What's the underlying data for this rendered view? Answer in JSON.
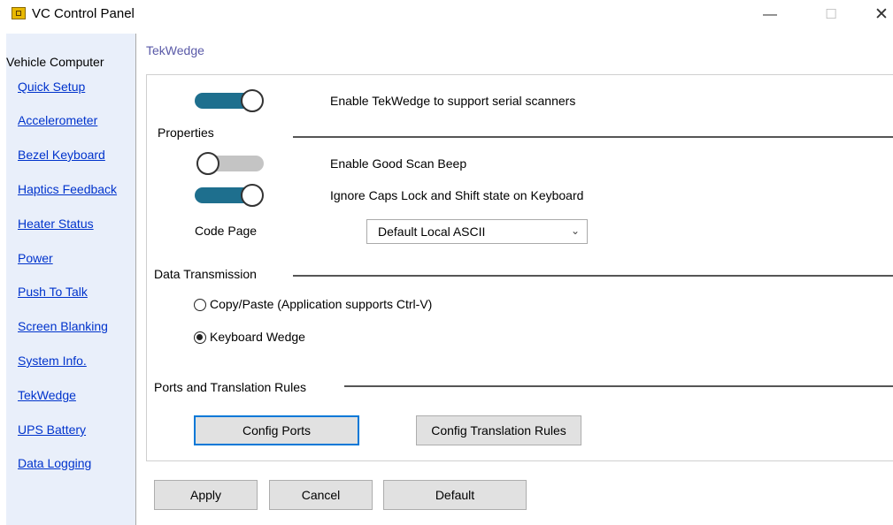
{
  "window": {
    "title": "VC Control Panel",
    "minimize": "—",
    "maximize": "☐",
    "close": "✕"
  },
  "sidebar": {
    "header": "Vehicle Computer",
    "items": [
      {
        "label": "Quick Setup"
      },
      {
        "label": "Accelerometer"
      },
      {
        "label": "Bezel Keyboard"
      },
      {
        "label": "Haptics Feedback"
      },
      {
        "label": "Heater Status"
      },
      {
        "label": "Power"
      },
      {
        "label": "Push To Talk"
      },
      {
        "label": "Screen Blanking"
      },
      {
        "label": "System Info."
      },
      {
        "label": "TekWedge"
      },
      {
        "label": "UPS Battery"
      },
      {
        "label": "Data Logging"
      }
    ]
  },
  "page": {
    "title": "TekWedge"
  },
  "main": {
    "enable_tekwedge": {
      "label": "Enable TekWedge to support serial scanners",
      "state": "on"
    },
    "properties": {
      "heading": "Properties",
      "good_scan_beep": {
        "label": "Enable Good Scan Beep",
        "state": "off"
      },
      "ignore_caps": {
        "label": "Ignore Caps Lock and Shift state on Keyboard",
        "state": "on"
      },
      "code_page": {
        "label": "Code Page",
        "value": "Default Local ASCII"
      }
    },
    "data_transmission": {
      "heading": "Data Transmission",
      "options": [
        {
          "label": "Copy/Paste (Application supports Ctrl-V)",
          "checked": false
        },
        {
          "label": "Keyboard Wedge",
          "checked": true
        }
      ]
    },
    "ports": {
      "heading": "Ports and Translation Rules",
      "config_ports": "Config Ports",
      "config_rules": "Config Translation Rules"
    }
  },
  "footer": {
    "apply": "Apply",
    "cancel": "Cancel",
    "default": "Default"
  },
  "colors": {
    "toggle_on": "#1e6f8e",
    "toggle_off": "#c4c4c4",
    "link": "#0033cc",
    "sidebar_bg": "#e9effa",
    "focus": "#0078d7"
  }
}
